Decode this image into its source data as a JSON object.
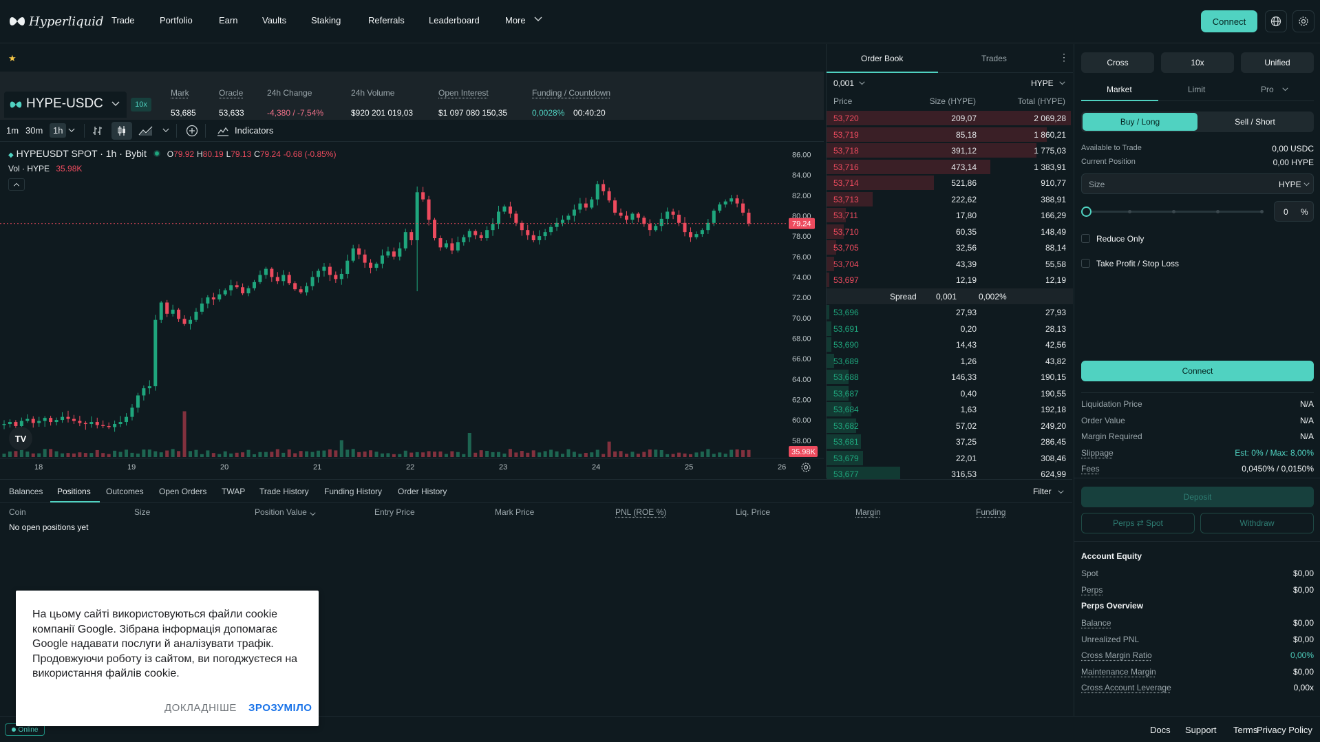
{
  "brand": {
    "name": "Hyperliquid"
  },
  "nav": {
    "items": [
      "Trade",
      "Portfolio",
      "Earn",
      "Vaults",
      "Staking",
      "Referrals",
      "Leaderboard",
      "More"
    ],
    "connect": "Connect"
  },
  "market": {
    "pair": "HYPE-USDC",
    "leverage": "10x",
    "stats": [
      {
        "label": "Mark",
        "value": "53,685",
        "underline": true
      },
      {
        "label": "Oracle",
        "value": "53,633",
        "underline": true
      },
      {
        "label": "24h Change",
        "value": "-4,380 / -7,54%",
        "underline": false,
        "color": "#ed7088"
      },
      {
        "label": "24h Volume",
        "value": "$920 201 019,03",
        "underline": false
      },
      {
        "label": "Open Interest",
        "value": "$1 097 080 150,35",
        "underline": true
      },
      {
        "label": "Funding / Countdown",
        "value": "0,0028%",
        "value2": "00:40:20",
        "underline": true,
        "color": "#50d2c1"
      }
    ]
  },
  "toolbar": {
    "intervals": [
      "1m",
      "30m",
      "1h"
    ],
    "indicators": "Indicators"
  },
  "chart_data": {
    "type": "candlestick",
    "symbol": "HYPEUSDT SPOT · 1h · Bybit",
    "ohlc": {
      "O": "79.92",
      "H": "80.19",
      "L": "79.13",
      "C": "79.24",
      "chg": "-0.68 (-0.85%)"
    },
    "volume_label": "Vol · HYPE",
    "volume_value": "35.98K",
    "last_price": "79.24",
    "y_ticks": [
      "86.00",
      "84.00",
      "82.00",
      "80.00",
      "78.00",
      "76.00",
      "74.00",
      "72.00",
      "70.00",
      "68.00",
      "66.00",
      "64.00",
      "62.00",
      "60.00",
      "58.00"
    ],
    "x_ticks": [
      "18",
      "19",
      "20",
      "21",
      "22",
      "23",
      "24",
      "25",
      "26"
    ],
    "ylim": [
      56.5,
      86.5
    ],
    "close_path": [
      59.6,
      59.8,
      59.4,
      59.9,
      60.1,
      59.7,
      59.9,
      60.2,
      59.8,
      60.0,
      60.3,
      60.1,
      59.9,
      59.7,
      59.6,
      59.8,
      59.5,
      59.4,
      59.3,
      59.6,
      59.8,
      60.3,
      61.2,
      62.4,
      63.1,
      63.3,
      69.8,
      71.5,
      70.4,
      70.8,
      69.9,
      69.4,
      69.8,
      70.6,
      71.4,
      72.0,
      71.8,
      72.3,
      72.7,
      73.2,
      73.0,
      72.4,
      72.9,
      73.5,
      74.2,
      74.8,
      74.0,
      73.6,
      74.2,
      73.4,
      72.8,
      72.5,
      73.1,
      74.0,
      74.6,
      75.0,
      74.2,
      73.8,
      74.3,
      75.6,
      76.8,
      76.2,
      75.4,
      74.9,
      75.3,
      76.1,
      76.5,
      76.0,
      76.8,
      78.4,
      77.6,
      82.3,
      81.6,
      79.6,
      77.8,
      76.9,
      77.3,
      76.6,
      77.4,
      77.9,
      78.5,
      78.1,
      77.8,
      78.6,
      79.2,
      80.4,
      80.9,
      80.2,
      79.3,
      78.6,
      78.1,
      77.6,
      78.0,
      78.4,
      78.9,
      79.3,
      79.6,
      80.0,
      80.6,
      81.2,
      80.8,
      81.6,
      83.1,
      82.4,
      81.5,
      80.3,
      80.0,
      79.6,
      80.2,
      79.8,
      79.2,
      78.6,
      79.0,
      79.7,
      80.4,
      80.1,
      79.3,
      78.4,
      77.9,
      78.2,
      78.6,
      79.3,
      80.5,
      81.1,
      81.4,
      81.7,
      81.2,
      80.3,
      79.24
    ],
    "vol_spikes": [
      [
        31,
        0.95
      ],
      [
        58,
        0.35
      ],
      [
        80,
        0.5
      ],
      [
        104,
        0.32
      ]
    ]
  },
  "orderbook": {
    "tabs": [
      "Order Book",
      "Trades"
    ],
    "tick": "0,001",
    "unit": "HYPE",
    "headers": [
      "Price",
      "Size (HYPE)",
      "Total (HYPE)"
    ],
    "asks": [
      {
        "p": "53,720",
        "s": "209,07",
        "t": "2 069,28",
        "d": 1.0
      },
      {
        "p": "53,719",
        "s": "85,18",
        "t": "1 860,21",
        "d": 0.9
      },
      {
        "p": "53,718",
        "s": "391,12",
        "t": "1 775,03",
        "d": 0.86
      },
      {
        "p": "53,716",
        "s": "473,14",
        "t": "1 383,91",
        "d": 0.67
      },
      {
        "p": "53,714",
        "s": "521,86",
        "t": "910,77",
        "d": 0.44
      },
      {
        "p": "53,713",
        "s": "222,62",
        "t": "388,91",
        "d": 0.19
      },
      {
        "p": "53,711",
        "s": "17,80",
        "t": "166,29",
        "d": 0.08
      },
      {
        "p": "53,710",
        "s": "60,35",
        "t": "148,49",
        "d": 0.07
      },
      {
        "p": "53,705",
        "s": "32,56",
        "t": "88,14",
        "d": 0.04
      },
      {
        "p": "53,704",
        "s": "43,39",
        "t": "55,58",
        "d": 0.03
      },
      {
        "p": "53,697",
        "s": "12,19",
        "t": "12,19",
        "d": 0.01
      }
    ],
    "spread": {
      "label": "Spread",
      "value": "0,001",
      "pct": "0,002%"
    },
    "bids": [
      {
        "p": "53,696",
        "s": "27,93",
        "t": "27,93",
        "d": 0.01
      },
      {
        "p": "53,691",
        "s": "0,20",
        "t": "28,13",
        "d": 0.02
      },
      {
        "p": "53,690",
        "s": "14,43",
        "t": "42,56",
        "d": 0.02
      },
      {
        "p": "53,689",
        "s": "1,26",
        "t": "43,82",
        "d": 0.03
      },
      {
        "p": "53,688",
        "s": "146,33",
        "t": "190,15",
        "d": 0.09
      },
      {
        "p": "53,687",
        "s": "0,40",
        "t": "190,55",
        "d": 0.09
      },
      {
        "p": "53,684",
        "s": "1,63",
        "t": "192,18",
        "d": 0.1
      },
      {
        "p": "53,682",
        "s": "57,02",
        "t": "249,20",
        "d": 0.12
      },
      {
        "p": "53,681",
        "s": "37,25",
        "t": "286,45",
        "d": 0.14
      },
      {
        "p": "53,679",
        "s": "22,01",
        "t": "308,46",
        "d": 0.15
      },
      {
        "p": "53,677",
        "s": "316,53",
        "t": "624,99",
        "d": 0.3
      }
    ]
  },
  "trade": {
    "margin_modes": [
      "Cross",
      "10x",
      "Unified"
    ],
    "order_types": [
      "Market",
      "Limit",
      "Pro"
    ],
    "sides": [
      "Buy / Long",
      "Sell / Short"
    ],
    "available_label": "Available to Trade",
    "available_value": "0,00 USDC",
    "position_label": "Current Position",
    "position_value": "0,00 HYPE",
    "size_placeholder": "Size",
    "size_unit": "HYPE",
    "pct_value": "0",
    "pct_sign": "%",
    "slider_fraction": 0,
    "reduce_only": "Reduce Only",
    "tpsl": "Take Profit / Stop Loss",
    "connect": "Connect",
    "info": [
      {
        "l": "Liquidation Price",
        "r": "N/A"
      },
      {
        "l": "Order Value",
        "r": "N/A"
      },
      {
        "l": "Margin Required",
        "r": "N/A"
      },
      {
        "l": "Slippage",
        "r": "Est: 0% / Max: 8,00%",
        "green": true,
        "u": true
      },
      {
        "l": "Fees",
        "r": "0,0450% / 0,0150%",
        "u": true
      }
    ],
    "deposit": "Deposit",
    "perps_spot": "Perps ⇄ Spot",
    "withdraw": "Withdraw",
    "account_equity": "Account Equity",
    "equity": [
      {
        "l": "Spot",
        "r": "$0,00"
      },
      {
        "l": "Perps",
        "r": "$0,00",
        "u": true
      }
    ],
    "perps_overview": "Perps Overview",
    "overview": [
      {
        "l": "Balance",
        "r": "$0,00",
        "u": true
      },
      {
        "l": "Unrealized PNL",
        "r": "$0,00"
      },
      {
        "l": "Cross Margin Ratio",
        "r": "0,00%",
        "u": true,
        "green": true
      },
      {
        "l": "Maintenance Margin",
        "r": "$0,00",
        "u": true
      },
      {
        "l": "Cross Account Leverage",
        "r": "0,00x",
        "u": true
      }
    ]
  },
  "bottom": {
    "tabs": [
      "Balances",
      "Positions",
      "Outcomes",
      "Open Orders",
      "TWAP",
      "Trade History",
      "Funding History",
      "Order History"
    ],
    "active_tab": "Positions",
    "filter": "Filter",
    "columns": [
      "Coin",
      "Size",
      "Position Value",
      "Entry Price",
      "Mark Price",
      "PNL (ROE %)",
      "Liq. Price",
      "Margin",
      "Funding"
    ],
    "empty": "No open positions yet"
  },
  "footer": {
    "status": "Online",
    "links": [
      "Docs",
      "Support",
      "Terms",
      "Privacy Policy"
    ]
  },
  "cookie": {
    "text": "На цьому сайті використовуються файли cookie компанії Google. Зібрана інформація допомагає Google надавати послуги й аналізувати трафік. Продовжуючи роботу із сайтом, ви погоджуєтеся на використання файлів cookie.",
    "more": "ДОКЛАДНІШЕ",
    "ok": "ЗРОЗУМІЛО"
  },
  "colors": {
    "accent": "#50d2c1",
    "up": "#1fa67d",
    "down": "#ed4b5e",
    "bg": "#0f1a1f"
  }
}
